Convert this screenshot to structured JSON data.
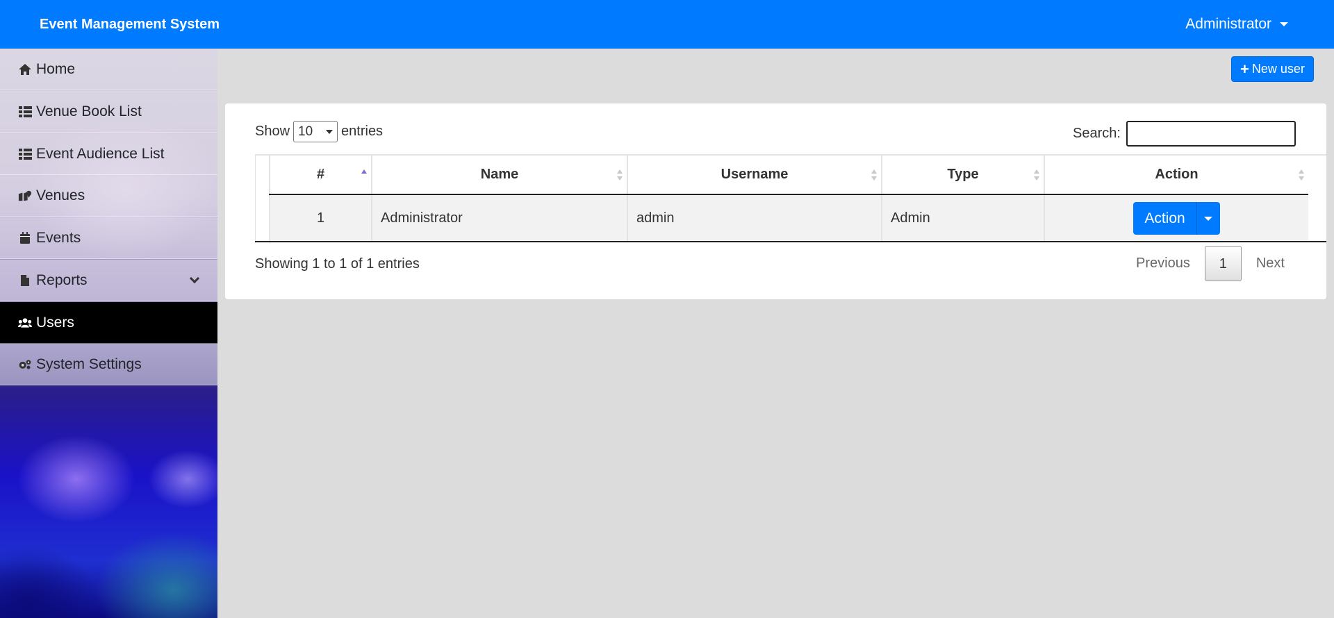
{
  "app": {
    "title": "Event Management System"
  },
  "user_menu": {
    "label": "Administrator"
  },
  "sidebar": {
    "items": [
      {
        "label": "Home",
        "icon": "home-icon"
      },
      {
        "label": "Venue Book List",
        "icon": "list-icon"
      },
      {
        "label": "Event Audience List",
        "icon": "list-icon"
      },
      {
        "label": "Venues",
        "icon": "map-marker-icon"
      },
      {
        "label": "Events",
        "icon": "calendar-icon"
      },
      {
        "label": "Reports",
        "icon": "file-icon"
      },
      {
        "label": "Users",
        "icon": "users-icon",
        "active": true
      },
      {
        "label": "System Settings",
        "icon": "cogs-icon"
      }
    ]
  },
  "toolbar": {
    "new_user_label": "New user"
  },
  "table_controls": {
    "show_label": "Show",
    "entries_value": "10",
    "entries_label": "entries",
    "search_label": "Search:"
  },
  "table": {
    "columns": [
      "#",
      "Name",
      "Username",
      "Type",
      "Action"
    ],
    "rows": [
      {
        "num": "1",
        "name": "Administrator",
        "username": "admin",
        "type": "Admin",
        "action": "Action"
      }
    ]
  },
  "footer": {
    "info": "Showing 1 to 1 of 1 entries",
    "previous": "Previous",
    "page": "1",
    "next": "Next"
  },
  "colors": {
    "primary": "#007bff",
    "active_nav": "#000000",
    "page_bg": "#dcdcdc"
  }
}
